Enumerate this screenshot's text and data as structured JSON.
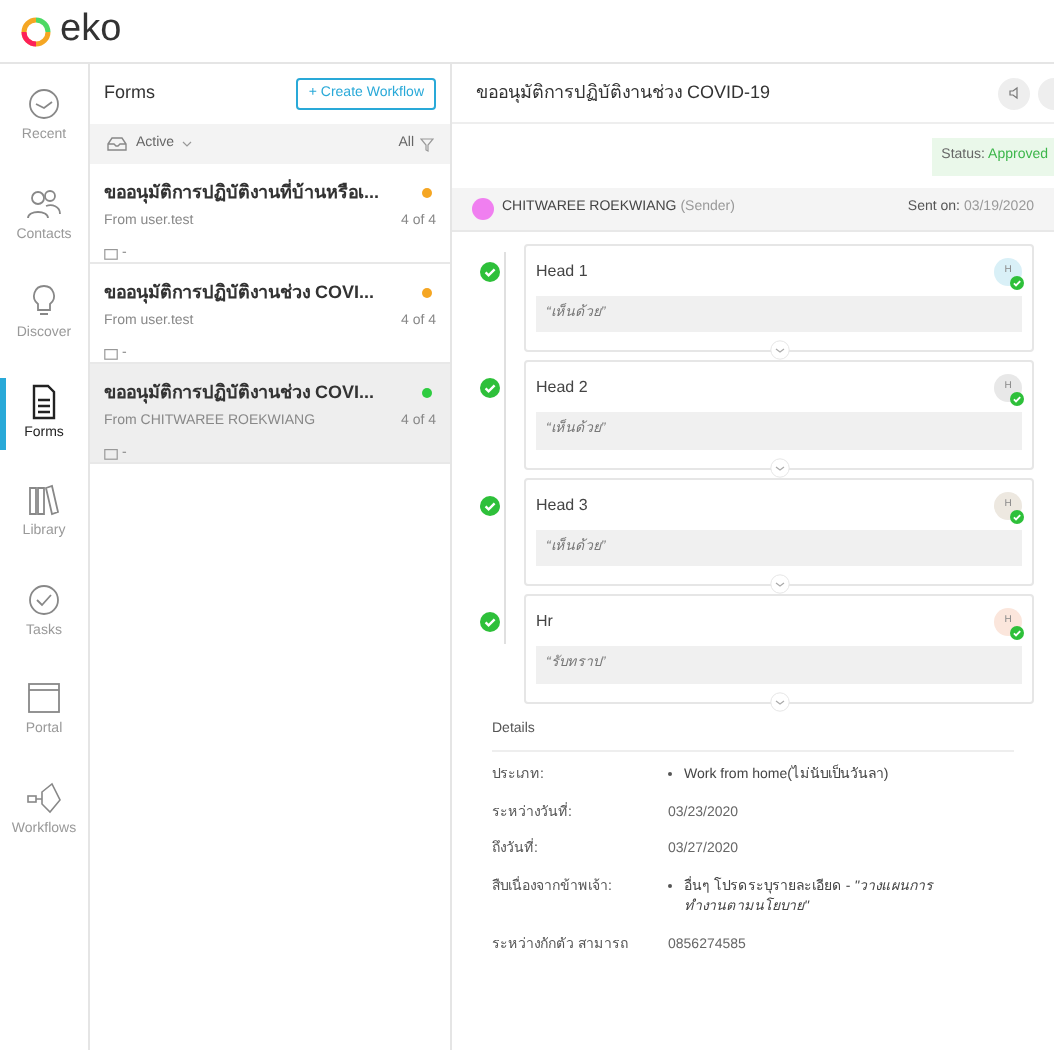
{
  "logo": {
    "text": "eko"
  },
  "nav": [
    {
      "label": "Recent",
      "kind": "clock",
      "selected": false
    },
    {
      "label": "Contacts",
      "kind": "people",
      "selected": false
    },
    {
      "label": "Discover",
      "kind": "bulb",
      "selected": false
    },
    {
      "label": "Forms",
      "kind": "doc",
      "selected": true
    },
    {
      "label": "Library",
      "kind": "books",
      "selected": false
    },
    {
      "label": "Tasks",
      "kind": "check",
      "selected": false
    },
    {
      "label": "Portal",
      "kind": "window",
      "selected": false
    },
    {
      "label": "Workflows",
      "kind": "flow",
      "selected": false
    }
  ],
  "forms_panel": {
    "title": "Forms",
    "create_button": "+ Create Workflow",
    "filter": "Active",
    "filter_all": "All",
    "items": [
      {
        "title": "ขออนุมัติการปฏิบัติงานที่บ้านหรือเ...",
        "from": "From user.test",
        "progress": "4 of 4",
        "date": "-",
        "color": "#f5a623",
        "selected": false
      },
      {
        "title": "ขออนุมัติการปฏิบัติงานช่วง COVI...",
        "from": "From user.test",
        "progress": "4 of 4",
        "date": "-",
        "color": "#f5a623",
        "selected": false
      },
      {
        "title": "ขออนุมัติการปฏิบัติงานช่วง COVI...",
        "from": "From CHITWAREE ROEKWIANG",
        "progress": "4 of 4",
        "date": "-",
        "color": "#2ecc40",
        "selected": true
      }
    ]
  },
  "detail": {
    "title": "ขออนุมัติการปฏิบัติงานช่วง COVID-19",
    "status_label": "Status:",
    "status": "Approved",
    "sender": {
      "name": "CHITWAREE ROEKWIANG",
      "role": "(Sender)",
      "sent_label": "Sent on:",
      "sent_date": "03/19/2020"
    },
    "steps": [
      {
        "name": "Head 1",
        "initial": "H",
        "comment": "“เห็นด้วย”",
        "done": true,
        "color": "#d9f0f7"
      },
      {
        "name": "Head 2",
        "initial": "H",
        "comment": "“เห็นด้วย”",
        "done": true,
        "color": "#e8e8e8"
      },
      {
        "name": "Head 3",
        "initial": "H",
        "comment": "“เห็นด้วย”",
        "done": true,
        "color": "#ede8e0"
      },
      {
        "name": "Hr",
        "initial": "H",
        "comment": "“รับทราบ”",
        "done": true,
        "color": "#fbe6dc"
      }
    ],
    "details_title": "Details",
    "fields": [
      {
        "label": "ประเภท:",
        "value": "Work from home(ไม่นับเป็นวันลา)",
        "bullet": true
      },
      {
        "label": "ระหว่างวันที่:",
        "value": "03/23/2020",
        "bullet": false
      },
      {
        "label": "ถึงวันที่:",
        "value": "03/27/2020",
        "bullet": false
      },
      {
        "label": "สืบเนื่องจากข้าพเจ้า:",
        "value": "อื่นๆ โปรดระบุรายละเอียด - *\"วางแผนการทำงานตามนโยบาย\"*",
        "bullet": true
      },
      {
        "label": "ระหว่างกักตัว สามารถ",
        "value": "0856274585",
        "bullet": false
      }
    ]
  }
}
